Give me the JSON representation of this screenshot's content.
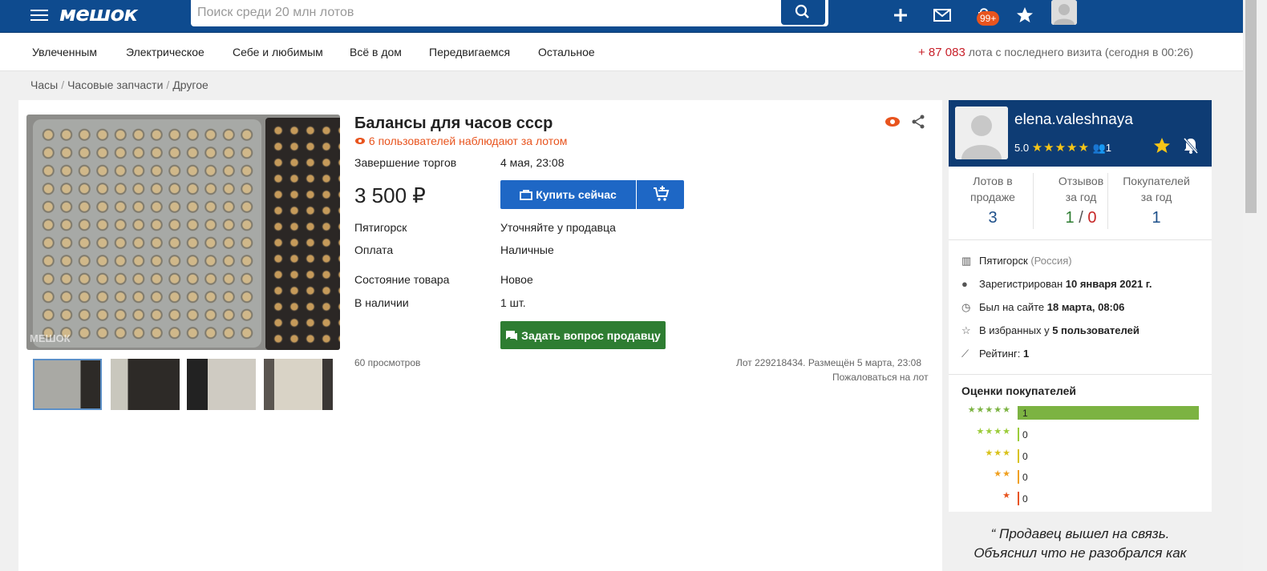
{
  "header": {
    "logo": "мешок",
    "search_placeholder": "Поиск среди 20 млн лотов",
    "cart_badge": "99+"
  },
  "categories": [
    "Увлеченным",
    "Электрическое",
    "Себе и любимым",
    "Всё в дом",
    "Передвигаемся",
    "Остальное"
  ],
  "visits": {
    "count": "+ 87 083",
    "text": "лота с последнего визита (сегодня в 00:26)"
  },
  "breadcrumbs": [
    "Часы",
    "Часовые запчасти",
    "Другое"
  ],
  "lot": {
    "title": "Балансы для часов ссср",
    "watchers": "6 пользователей наблюдают за лотом",
    "end_label": "Завершение торгов",
    "end_value": "4 мая, 23:08",
    "price": "3 500 ₽",
    "buy_label": "Купить сейчас",
    "city_label": "Пятигорск",
    "city_value": "Уточняйте у продавца",
    "pay_label": "Оплата",
    "pay_value": "Наличные",
    "cond_label": "Состояние товара",
    "cond_value": "Новое",
    "stock_label": "В наличии",
    "stock_value": "1 шт.",
    "ask_label": "Задать вопрос продавцу",
    "views": "60 просмотров",
    "lot_info": "Лот 229218434. Размещён 5 марта, 23:08",
    "report": "Пожаловаться на лот",
    "watermark": "МЕШОК"
  },
  "seller": {
    "name": "elena.valeshnaya",
    "rating": "5.0",
    "stars": "★★★★★",
    "followers": "1",
    "stats": [
      {
        "label1": "Лотов в",
        "label2": "продаже",
        "value": "3"
      },
      {
        "label1": "Отзывов",
        "label2": "за год",
        "pos": "1",
        "slash": "/",
        "neg": "0"
      },
      {
        "label1": "Покупателей",
        "label2": "за год",
        "value": "1"
      }
    ],
    "city": "Пятигорск",
    "country": "(Россия)",
    "registered_label": "Зарегистрирован",
    "registered_value": "10 января 2021 г.",
    "seen_label": "Был на сайте",
    "seen_value": "18 марта, 08:06",
    "fav_label": "В избранных у",
    "fav_value": "5 пользователей",
    "rating_label": "Рейтинг:",
    "rating_value": "1",
    "ratings_title": "Оценки покупателей",
    "ratings": [
      {
        "stars": "★★★★★",
        "count": "1",
        "color": "#7cb342",
        "fraction": 1
      },
      {
        "stars": "★★★★",
        "count": "0",
        "color": "#9ccc3a",
        "fraction": 0
      },
      {
        "stars": "★★★",
        "count": "0",
        "color": "#d9c21b",
        "fraction": 0
      },
      {
        "stars": "★★",
        "count": "0",
        "color": "#f0a020",
        "fraction": 0
      },
      {
        "stars": "★",
        "count": "0",
        "color": "#e8541e",
        "fraction": 0
      }
    ],
    "quote1": "“ Продавец вышел на связь.",
    "quote2": "Объяснил что не разобрался как"
  },
  "colors": {
    "brand": "#0e4b8f",
    "buy": "#1e67c5",
    "ask": "#2e7d32",
    "accent": "#e8541e"
  }
}
